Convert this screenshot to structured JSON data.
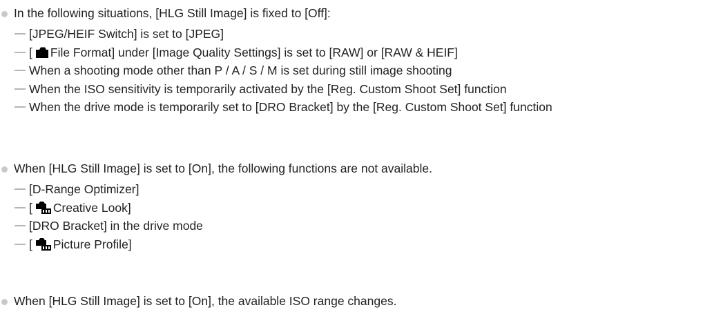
{
  "notes": [
    {
      "head": "In the following situations, [HLG Still Image] is fixed to [Off]:",
      "items": [
        {
          "pre": "[JPEG/HEIF Switch] is set to [JPEG]"
        },
        {
          "pre": "[",
          "icon": "still-camera-icon",
          "post": "File Format] under [Image Quality Settings] is set to [RAW] or [RAW & HEIF]"
        },
        {
          "pre": "When a shooting mode other than P / A / S / M is set during still image shooting"
        },
        {
          "pre": "When the ISO sensitivity is temporarily activated by the [Reg. Custom Shoot Set] function"
        },
        {
          "pre": "When the drive mode is temporarily set to [DRO Bracket] by the [Reg. Custom Shoot Set] function"
        }
      ]
    },
    {
      "head": "When [HLG Still Image] is set to [On], the following functions are not available.",
      "items": [
        {
          "pre": "[D-Range Optimizer]"
        },
        {
          "pre": "[",
          "icon": "still-movie-camera-icon",
          "post": "Creative Look]"
        },
        {
          "pre": "[DRO Bracket] in the drive mode"
        },
        {
          "pre": "[",
          "icon": "still-movie-camera-icon",
          "post": "Picture Profile]"
        }
      ]
    },
    {
      "head": "When [HLG Still Image] is set to [On], the available ISO range changes.",
      "items": []
    }
  ],
  "colors": {
    "text": "#222222",
    "bullet": "#c9c9c9",
    "dash": "#b5b5b5",
    "icon": "#000000"
  }
}
